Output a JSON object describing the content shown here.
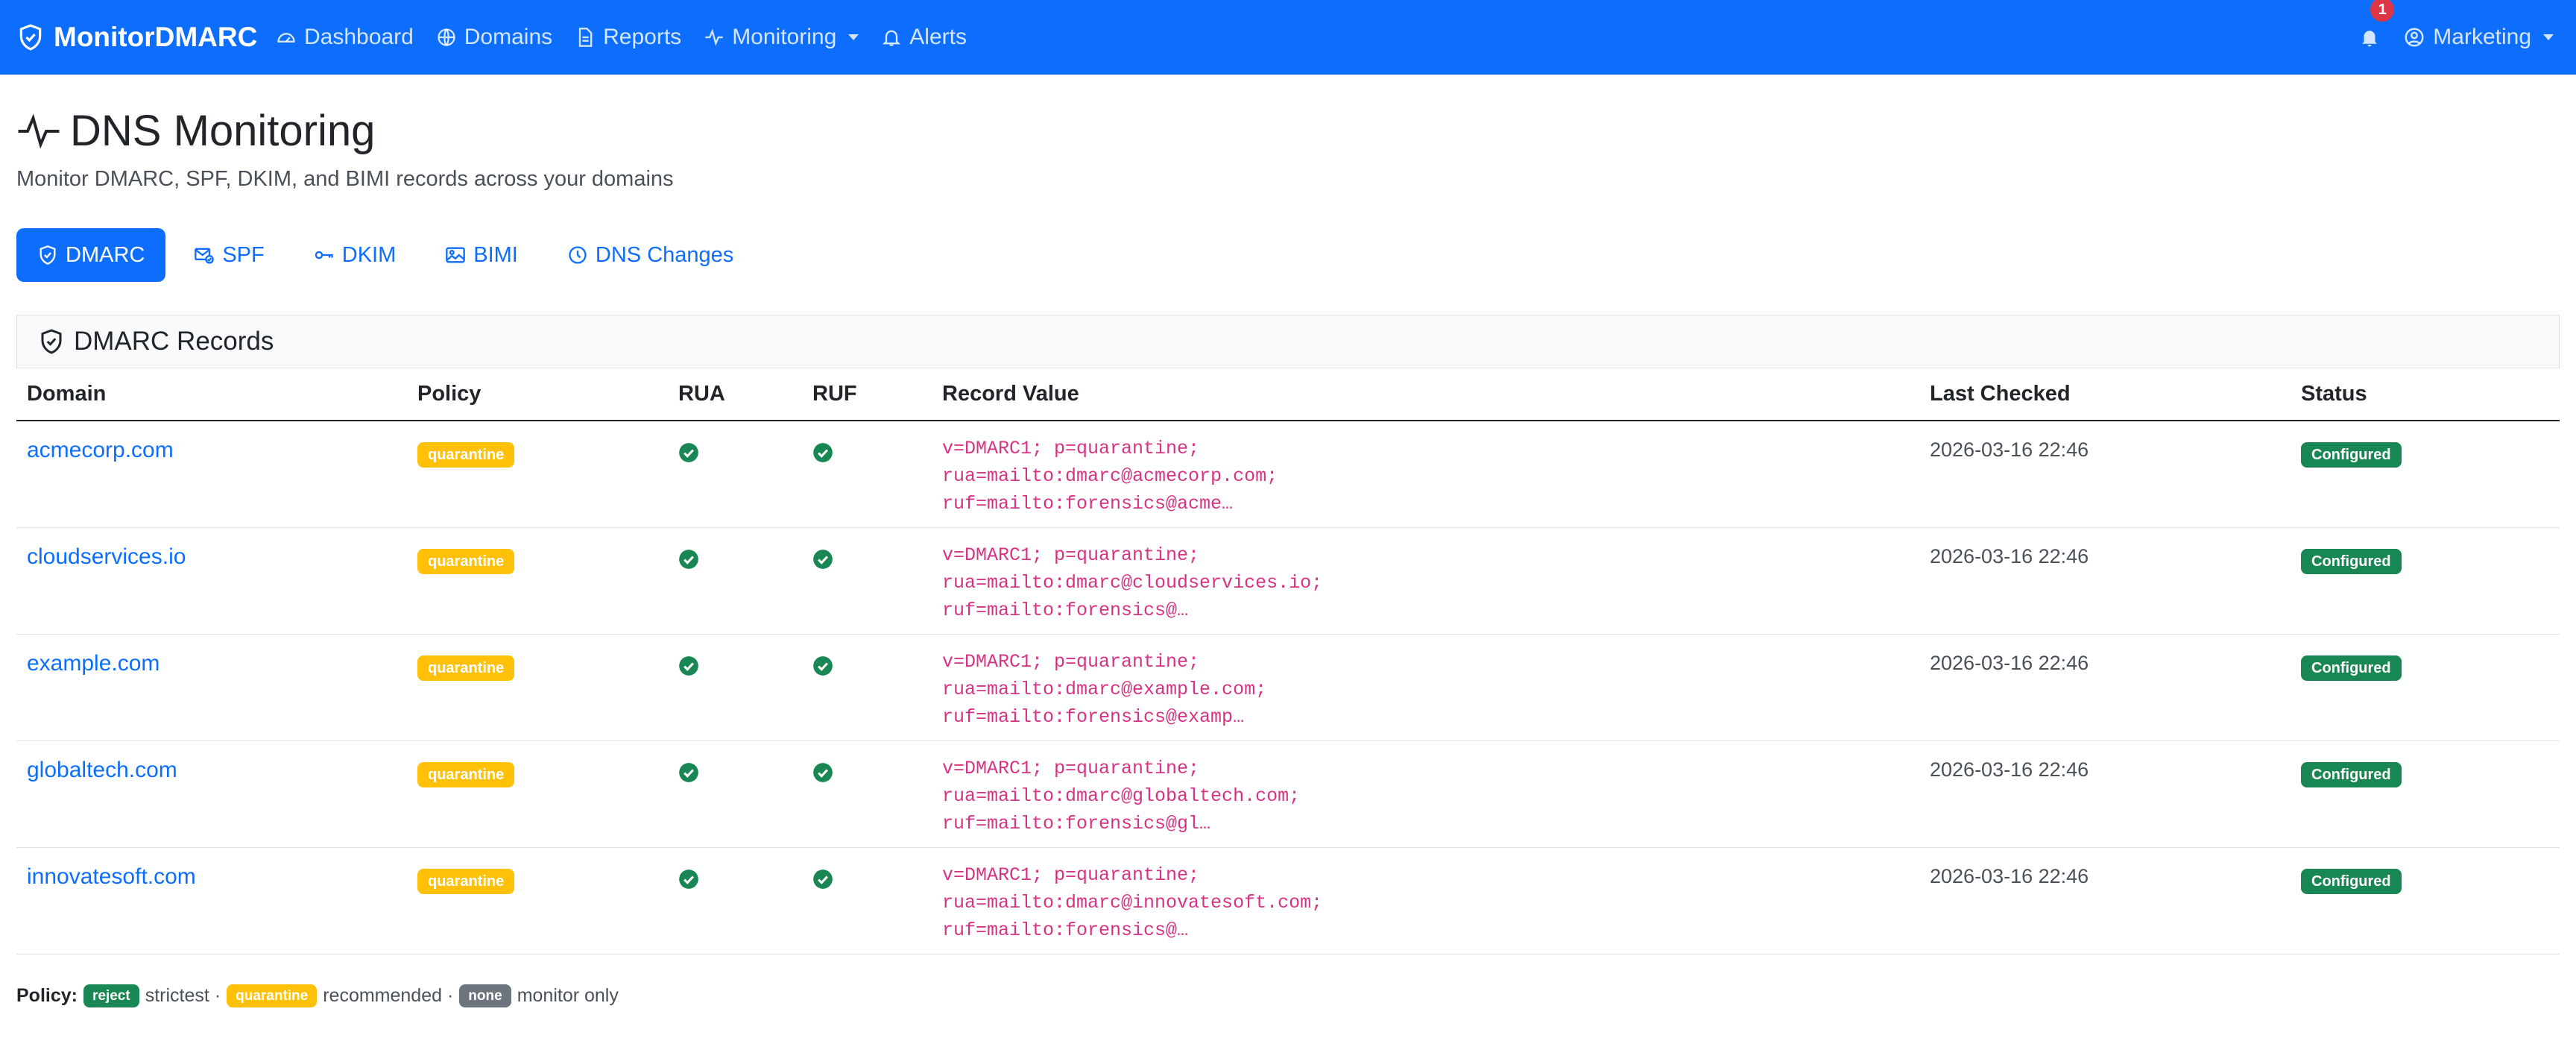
{
  "navbar": {
    "brand": "MonitorDMARC",
    "items": [
      {
        "label": "Dashboard",
        "icon": "speedometer-icon"
      },
      {
        "label": "Domains",
        "icon": "globe-icon"
      },
      {
        "label": "Reports",
        "icon": "file-text-icon"
      },
      {
        "label": "Monitoring",
        "icon": "activity-icon",
        "dropdown": true
      },
      {
        "label": "Alerts",
        "icon": "bell-icon"
      }
    ],
    "notification_count": "1",
    "user": "Marketing"
  },
  "header": {
    "title": "DNS Monitoring",
    "subtitle": "Monitor DMARC, SPF, DKIM, and BIMI records across your domains"
  },
  "tabs": [
    {
      "label": "DMARC",
      "icon": "shield-icon",
      "active": true
    },
    {
      "label": "SPF",
      "icon": "envelope-check-icon",
      "active": false
    },
    {
      "label": "DKIM",
      "icon": "key-icon",
      "active": false
    },
    {
      "label": "BIMI",
      "icon": "image-icon",
      "active": false
    },
    {
      "label": "DNS Changes",
      "icon": "clock-history-icon",
      "active": false
    }
  ],
  "card": {
    "title": "DMARC Records",
    "columns": [
      "Domain",
      "Policy",
      "RUA",
      "RUF",
      "Record Value",
      "Last Checked",
      "Status"
    ],
    "rows": [
      {
        "domain": "acmecorp.com",
        "policy": "quarantine",
        "rua": true,
        "ruf": true,
        "record": [
          "v=DMARC1; p=quarantine;",
          "rua=mailto:dmarc@acmecorp.com;",
          "ruf=mailto:forensics@acme…"
        ],
        "last_checked": "2026-03-16 22:46",
        "status": "Configured"
      },
      {
        "domain": "cloudservices.io",
        "policy": "quarantine",
        "rua": true,
        "ruf": true,
        "record": [
          "v=DMARC1; p=quarantine;",
          "rua=mailto:dmarc@cloudservices.io;",
          "ruf=mailto:forensics@…"
        ],
        "last_checked": "2026-03-16 22:46",
        "status": "Configured"
      },
      {
        "domain": "example.com",
        "policy": "quarantine",
        "rua": true,
        "ruf": true,
        "record": [
          "v=DMARC1; p=quarantine;",
          "rua=mailto:dmarc@example.com;",
          "ruf=mailto:forensics@examp…"
        ],
        "last_checked": "2026-03-16 22:46",
        "status": "Configured"
      },
      {
        "domain": "globaltech.com",
        "policy": "quarantine",
        "rua": true,
        "ruf": true,
        "record": [
          "v=DMARC1; p=quarantine;",
          "rua=mailto:dmarc@globaltech.com;",
          "ruf=mailto:forensics@gl…"
        ],
        "last_checked": "2026-03-16 22:46",
        "status": "Configured"
      },
      {
        "domain": "innovatesoft.com",
        "policy": "quarantine",
        "rua": true,
        "ruf": true,
        "record": [
          "v=DMARC1; p=quarantine;",
          "rua=mailto:dmarc@innovatesoft.com;",
          "ruf=mailto:forensics@…"
        ],
        "last_checked": "2026-03-16 22:46",
        "status": "Configured"
      }
    ]
  },
  "legend": {
    "label": "Policy:",
    "items": [
      {
        "badge": "reject",
        "text": "strictest ·",
        "color": "#198754"
      },
      {
        "badge": "quarantine",
        "text": "recommended ·",
        "color": "#ffc107"
      },
      {
        "badge": "none",
        "text": "monitor only",
        "color": "#6c757d"
      }
    ]
  },
  "colors": {
    "primary": "#0d6efd",
    "success": "#198754",
    "warning": "#ffc107",
    "secondary": "#6c757d",
    "code": "#d63384"
  }
}
